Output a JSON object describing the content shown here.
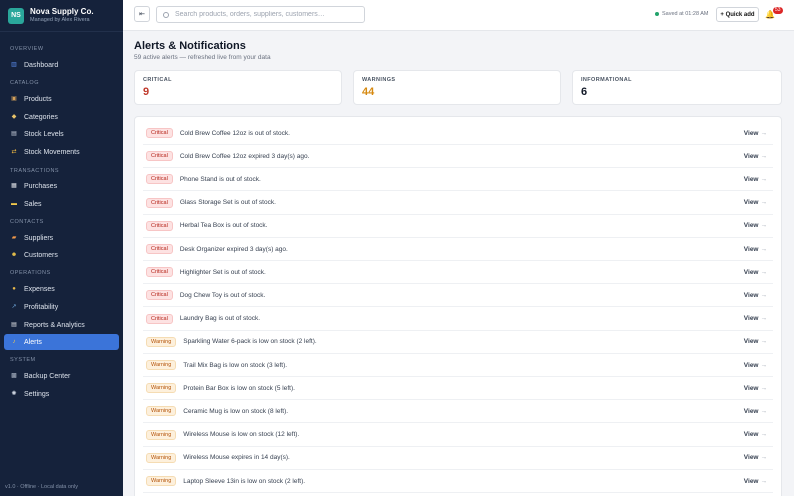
{
  "brand": {
    "initials": "NS",
    "name": "Nova Supply Co.",
    "subtitle": "Managed by Alex Rivera"
  },
  "sidebar": {
    "sections": [
      "OVERVIEW",
      "CATALOG",
      "TRANSACTIONS",
      "CONTACTS",
      "OPERATIONS",
      "SYSTEM"
    ],
    "items": [
      {
        "label": "Dashboard",
        "icon": "chart-icon"
      },
      {
        "label": "Products",
        "icon": "box-icon"
      },
      {
        "label": "Categories",
        "icon": "tag-icon"
      },
      {
        "label": "Stock Levels",
        "icon": "clipboard-icon"
      },
      {
        "label": "Stock Movements",
        "icon": "arrows-icon"
      },
      {
        "label": "Purchases",
        "icon": "receipt-icon"
      },
      {
        "label": "Sales",
        "icon": "card-icon"
      },
      {
        "label": "Suppliers",
        "icon": "truck-icon"
      },
      {
        "label": "Customers",
        "icon": "people-icon"
      },
      {
        "label": "Expenses",
        "icon": "money-bag-icon"
      },
      {
        "label": "Profitability",
        "icon": "trend-icon"
      },
      {
        "label": "Reports & Analytics",
        "icon": "report-icon"
      },
      {
        "label": "Alerts",
        "icon": "bell-icon"
      },
      {
        "label": "Backup Center",
        "icon": "database-icon"
      },
      {
        "label": "Settings",
        "icon": "gear-icon"
      }
    ],
    "active": "Alerts",
    "footer": "v1.0 · Offline · Local data only"
  },
  "topbar": {
    "search_placeholder": "Search products, orders, suppliers, customers…",
    "saved": "Saved at 01:28 AM",
    "quick_add": "+ Quick add",
    "alert_count": "53"
  },
  "page": {
    "title": "Alerts & Notifications",
    "subtitle": "59 active alerts — refreshed live from your data"
  },
  "summary": [
    {
      "label": "CRITICAL",
      "value": "9",
      "color": "#c0392b"
    },
    {
      "label": "WARNINGS",
      "value": "44",
      "color": "#d68910"
    },
    {
      "label": "INFORMATIONAL",
      "value": "6",
      "color": "#111827"
    }
  ],
  "alerts": [
    {
      "level": "Critical",
      "message": "Cold Brew Coffee 12oz is out of stock.",
      "action": "View"
    },
    {
      "level": "Critical",
      "message": "Cold Brew Coffee 12oz expired 3 day(s) ago.",
      "action": "View"
    },
    {
      "level": "Critical",
      "message": "Phone Stand is out of stock.",
      "action": "View"
    },
    {
      "level": "Critical",
      "message": "Glass Storage Set is out of stock.",
      "action": "View"
    },
    {
      "level": "Critical",
      "message": "Herbal Tea Box is out of stock.",
      "action": "View"
    },
    {
      "level": "Critical",
      "message": "Desk Organizer expired 3 day(s) ago.",
      "action": "View"
    },
    {
      "level": "Critical",
      "message": "Highlighter Set is out of stock.",
      "action": "View"
    },
    {
      "level": "Critical",
      "message": "Dog Chew Toy is out of stock.",
      "action": "View"
    },
    {
      "level": "Critical",
      "message": "Laundry Bag is out of stock.",
      "action": "View"
    },
    {
      "level": "Warning",
      "message": "Sparkling Water 6-pack is low on stock (2 left).",
      "action": "View"
    },
    {
      "level": "Warning",
      "message": "Trail Mix Bag is low on stock (3 left).",
      "action": "View"
    },
    {
      "level": "Warning",
      "message": "Protein Bar Box is low on stock (5 left).",
      "action": "View"
    },
    {
      "level": "Warning",
      "message": "Ceramic Mug is low on stock (8 left).",
      "action": "View"
    },
    {
      "level": "Warning",
      "message": "Wireless Mouse is low on stock (12 left).",
      "action": "View"
    },
    {
      "level": "Warning",
      "message": "Wireless Mouse expires in 14 day(s).",
      "action": "View"
    },
    {
      "level": "Warning",
      "message": "Laptop Sleeve 13in is low on stock (2 left).",
      "action": "View"
    }
  ]
}
